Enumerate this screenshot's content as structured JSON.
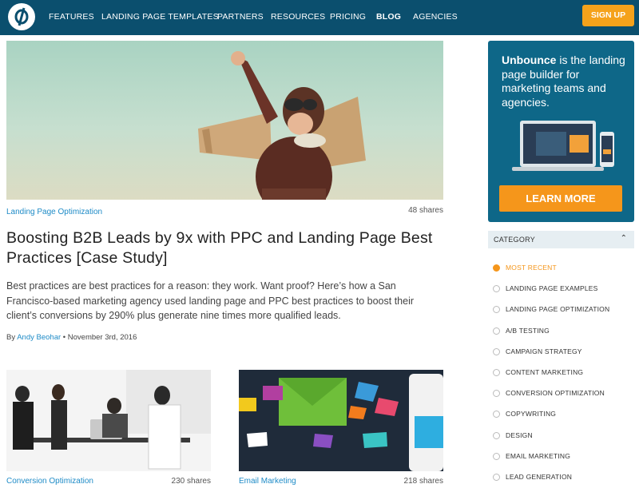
{
  "nav": {
    "logo_icon": "unbounce-logo-icon",
    "items": [
      {
        "label": "FEATURES"
      },
      {
        "label": "LANDING PAGE TEMPLATES"
      },
      {
        "label": "PARTNERS"
      },
      {
        "label": "RESOURCES"
      },
      {
        "label": "PRICING"
      },
      {
        "label": "BLOG"
      },
      {
        "label": "AGENCIES"
      }
    ],
    "signup_label": "SIGN UP"
  },
  "featured": {
    "category": "Landing Page Optimization",
    "shares": "48 shares",
    "title": "Boosting B2B Leads by 9x with PPC and Landing Page Best Practices [Case Study]",
    "excerpt": "Best practices are best practices for a reason: they work. Want proof? Here’s how a San Francisco-based marketing agency used landing page and PPC best practices to boost their client’s conversions by 290% plus generate nine times more qualified leads.",
    "byline_prefix": "By",
    "author": "Andy Beohar",
    "date": "November 3rd, 2016"
  },
  "cards": [
    {
      "category": "Conversion Optimization",
      "shares": "230 shares"
    },
    {
      "category": "Email Marketing",
      "shares": "218 shares"
    }
  ],
  "ad": {
    "brand": "Unbounce",
    "text": "is the landing page builder for marketing teams and agencies.",
    "button_label": "LEARN MORE"
  },
  "category_panel": {
    "title": "CATEGORY",
    "items": [
      {
        "label": "MOST RECENT",
        "selected": true
      },
      {
        "label": "LANDING PAGE EXAMPLES",
        "selected": false
      },
      {
        "label": "LANDING PAGE OPTIMIZATION",
        "selected": false
      },
      {
        "label": "A/B TESTING",
        "selected": false
      },
      {
        "label": "CAMPAIGN STRATEGY",
        "selected": false
      },
      {
        "label": "CONTENT MARKETING",
        "selected": false
      },
      {
        "label": "CONVERSION OPTIMIZATION",
        "selected": false
      },
      {
        "label": "COPYWRITING",
        "selected": false
      },
      {
        "label": "DESIGN",
        "selected": false
      },
      {
        "label": "EMAIL MARKETING",
        "selected": false
      },
      {
        "label": "LEAD GENERATION",
        "selected": false
      }
    ]
  },
  "colors": {
    "nav_bg": "#0b4f6e",
    "accent_orange": "#f5961b",
    "link_blue": "#1e8bc7",
    "ad_bg": "#0e6788"
  }
}
